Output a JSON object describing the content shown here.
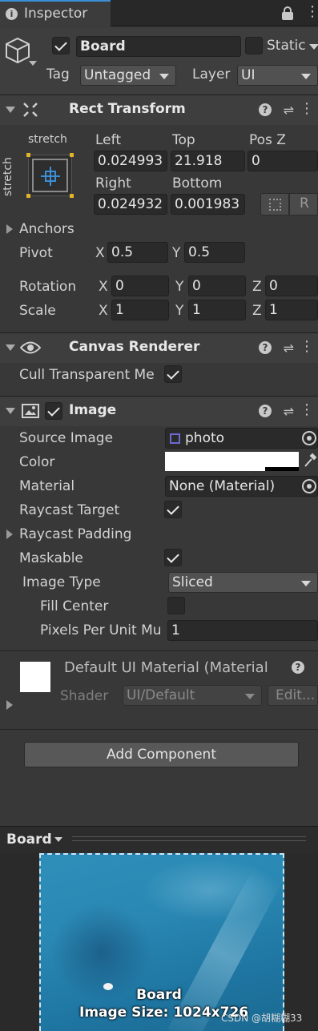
{
  "tab": {
    "title": "Inspector"
  },
  "gameobject": {
    "name": "Board",
    "static_label": "Static",
    "tag_label": "Tag",
    "tag_value": "Untagged",
    "layer_label": "Layer",
    "layer_value": "UI"
  },
  "rect_transform": {
    "title": "Rect Transform",
    "anchor_preset_top": "stretch",
    "anchor_preset_side": "stretch",
    "left_label": "Left",
    "left_value": "0.024993",
    "top_label": "Top",
    "top_value": "21.918",
    "posz_label": "Pos Z",
    "posz_value": "0",
    "right_label": "Right",
    "right_value": "0.024932",
    "bottom_label": "Bottom",
    "bottom_value": "0.001983",
    "r_button": "R",
    "anchors_label": "Anchors",
    "pivot_label": "Pivot",
    "pivot_x_label": "X",
    "pivot_x": "0.5",
    "pivot_y_label": "Y",
    "pivot_y": "0.5",
    "rotation_label": "Rotation",
    "rot_x_label": "X",
    "rot_x": "0",
    "rot_y_label": "Y",
    "rot_y": "0",
    "rot_z_label": "Z",
    "rot_z": "0",
    "scale_label": "Scale",
    "scale_x_label": "X",
    "scale_x": "1",
    "scale_y_label": "Y",
    "scale_y": "1",
    "scale_z_label": "Z",
    "scale_z": "1"
  },
  "canvas_renderer": {
    "title": "Canvas Renderer",
    "cull_label": "Cull Transparent Me",
    "cull_checked": true
  },
  "image": {
    "title": "Image",
    "source_label": "Source Image",
    "source_value": "photo",
    "color_label": "Color",
    "color_value": "#ffffff",
    "material_label": "Material",
    "material_value": "None (Material)",
    "raycast_target_label": "Raycast Target",
    "raycast_padding_label": "Raycast Padding",
    "maskable_label": "Maskable",
    "image_type_label": "Image Type",
    "image_type_value": "Sliced",
    "fill_center_label": "Fill Center",
    "ppu_label": "Pixels Per Unit Mu",
    "ppu_value": "1"
  },
  "material_block": {
    "title": "Default UI Material (Material",
    "shader_label": "Shader",
    "shader_value": "UI/Default",
    "edit_button": "Edit..."
  },
  "add_component": {
    "label": "Add Component"
  },
  "preview": {
    "dropdown": "Board",
    "caption_name": "Board",
    "caption_size": "Image Size: 1024x726",
    "watermark": "CSDN @胡糊糊33"
  },
  "colors": {
    "accent": "#3a8fd6",
    "panel": "#383838",
    "header": "#3e3e3e"
  }
}
